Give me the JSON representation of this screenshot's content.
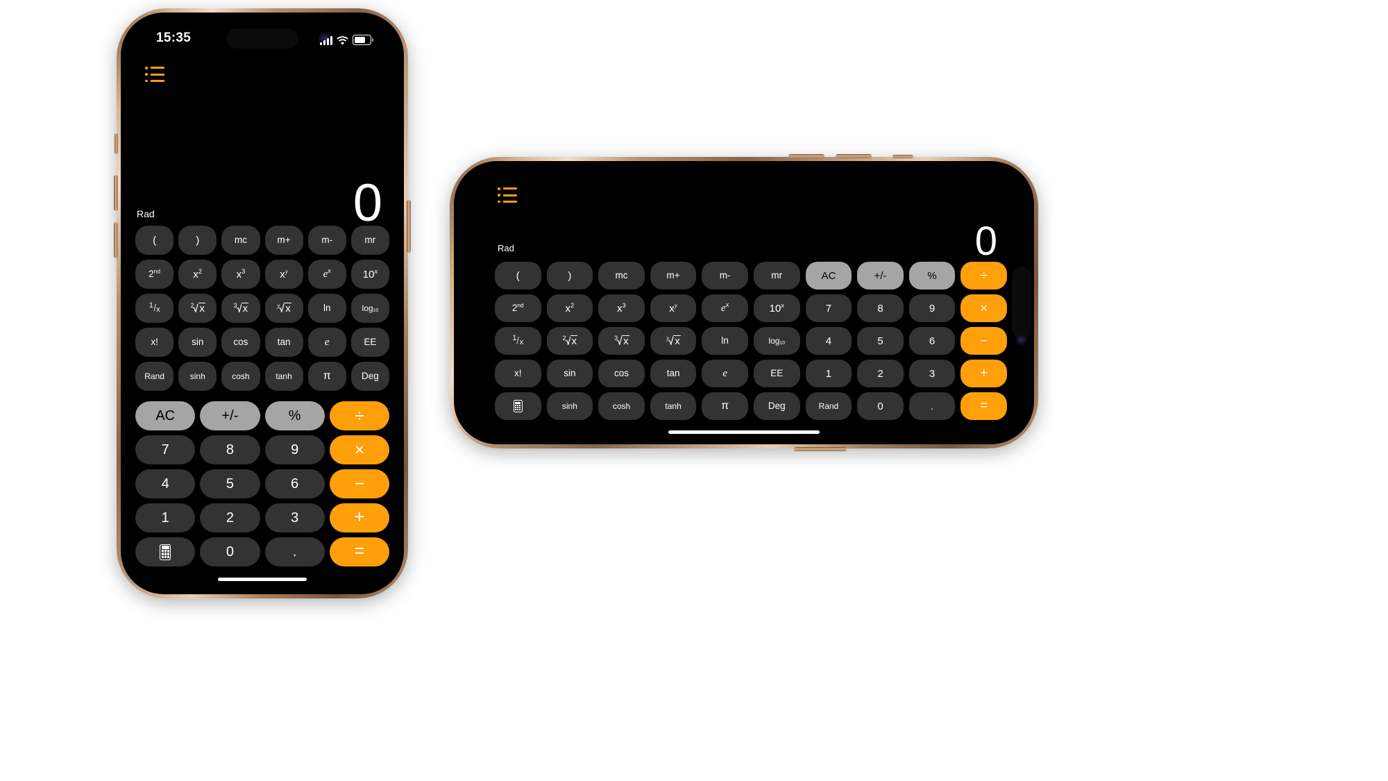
{
  "theme": {
    "background": "#000000",
    "key_bg": "#333333",
    "key_util_bg": "#a5a5a5",
    "key_op_bg": "#ff9f0a",
    "accent": "#ff9f0a",
    "text": "#ffffff"
  },
  "portrait": {
    "status_bar": {
      "time": "15:35",
      "cellular_icon": "signal-bars-icon",
      "wifi_icon": "wifi-icon",
      "battery_icon": "battery-icon",
      "dynamic_island": "dynamic-island"
    },
    "menu_icon": "list-bullet-icon",
    "display_value": "0",
    "mode_label": "Rad",
    "science_rows": [
      [
        "(",
        ")",
        "mc",
        "m+",
        "m-",
        "mr"
      ],
      [
        "2nd",
        "x2",
        "x3",
        "xy",
        "ex",
        "10x"
      ],
      [
        "1/x",
        "2rootx",
        "3rootx",
        "yrootx",
        "ln",
        "log10"
      ],
      [
        "x!",
        "sin",
        "cos",
        "tan",
        "e",
        "EE"
      ],
      [
        "Rand",
        "sinh",
        "cosh",
        "tanh",
        "pi",
        "Deg"
      ]
    ],
    "keypad_rows": [
      [
        "AC",
        "+/-",
        "%",
        "div"
      ],
      [
        "7",
        "8",
        "9",
        "mul"
      ],
      [
        "4",
        "5",
        "6",
        "sub"
      ],
      [
        "1",
        "2",
        "3",
        "add"
      ],
      [
        "calc",
        "0",
        ".",
        "eq"
      ]
    ],
    "home_indicator": "home-indicator"
  },
  "landscape": {
    "menu_icon": "list-bullet-icon",
    "display_value": "0",
    "mode_label": "Rad",
    "rows": [
      [
        "(",
        ")",
        "mc",
        "m+",
        "m-",
        "mr",
        "AC",
        "+/-",
        "%",
        "div"
      ],
      [
        "2nd",
        "x2",
        "x3",
        "xy",
        "ex",
        "10x",
        "7",
        "8",
        "9",
        "mul"
      ],
      [
        "1/x",
        "2rootx",
        "3rootx",
        "yrootx",
        "ln",
        "log10",
        "4",
        "5",
        "6",
        "sub"
      ],
      [
        "x!",
        "sin",
        "cos",
        "tan",
        "e",
        "EE",
        "1",
        "2",
        "3",
        "add"
      ],
      [
        "calc",
        "sinh",
        "cosh",
        "tanh",
        "pi",
        "Deg",
        "Rand",
        "0",
        ".",
        "eq"
      ]
    ],
    "home_indicator": "home-indicator"
  },
  "key_labels": {
    "(": "(",
    ")": ")",
    "mc": "mc",
    "m+": "m+",
    "m-": "m-",
    "mr": "mr",
    "2nd": "2nd",
    "x2": "x²",
    "x3": "x³",
    "xy": "xʸ",
    "ex": "eˣ",
    "10x": "10ˣ",
    "1/x": "¹⁄ₓ",
    "2rootx": "²√x",
    "3rootx": "³√x",
    "yrootx": "ʸ√x",
    "ln": "ln",
    "log10": "log₁₀",
    "x!": "x!",
    "sin": "sin",
    "cos": "cos",
    "tan": "tan",
    "e": "e",
    "EE": "EE",
    "Rand": "Rand",
    "sinh": "sinh",
    "cosh": "cosh",
    "tanh": "tanh",
    "pi": "π",
    "Deg": "Deg",
    "AC": "AC",
    "+/-": "+/-",
    "%": "%",
    "div": "÷",
    "mul": "×",
    "sub": "−",
    "add": "+",
    "eq": "=",
    "0": "0",
    "1": "1",
    "2": "2",
    "3": "3",
    "4": "4",
    "5": "5",
    "6": "6",
    "7": "7",
    "8": "8",
    "9": "9",
    ".": ".",
    "calc": "calculator-icon"
  },
  "key_names": {
    "(": "key-open-paren",
    ")": "key-close-paren",
    "mc": "key-memory-clear",
    "m+": "key-memory-add",
    "m-": "key-memory-subtract",
    "mr": "key-memory-recall",
    "2nd": "key-second-function",
    "x2": "key-x-squared",
    "x3": "key-x-cubed",
    "xy": "key-x-to-y",
    "ex": "key-e-to-x",
    "10x": "key-ten-to-x",
    "1/x": "key-reciprocal",
    "2rootx": "key-square-root",
    "3rootx": "key-cube-root",
    "yrootx": "key-y-root",
    "ln": "key-natural-log",
    "log10": "key-log-base-10",
    "x!": "key-factorial",
    "sin": "key-sine",
    "cos": "key-cosine",
    "tan": "key-tangent",
    "e": "key-euler-number",
    "EE": "key-exponent-entry",
    "Rand": "key-random",
    "sinh": "key-hyperbolic-sine",
    "cosh": "key-hyperbolic-cosine",
    "tanh": "key-hyperbolic-tangent",
    "pi": "key-pi",
    "Deg": "key-degrees-toggle",
    "AC": "key-all-clear",
    "+/-": "key-sign-toggle",
    "%": "key-percent",
    "div": "key-divide",
    "mul": "key-multiply",
    "sub": "key-subtract",
    "add": "key-add",
    "eq": "key-equals",
    "0": "key-0",
    "1": "key-1",
    "2": "key-2",
    "3": "key-3",
    "4": "key-4",
    "5": "key-5",
    "6": "key-6",
    "7": "key-7",
    "8": "key-8",
    "9": "key-9",
    ".": "key-decimal-point",
    "calc": "key-basic-calculator"
  }
}
